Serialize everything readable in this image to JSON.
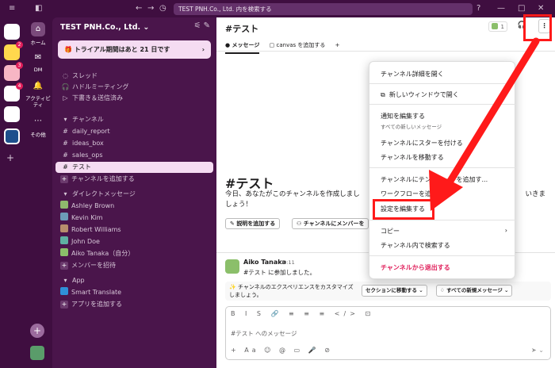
{
  "titlebar": {
    "search_text": "TEST PNH.Co., Ltd. 内を検索する",
    "help": "?",
    "min": "—",
    "max": "□",
    "close": "✕"
  },
  "rail": {
    "ws_badges": [
      "2",
      "3",
      "4"
    ]
  },
  "nav": [
    {
      "icon": "⌂",
      "label": "ホーム"
    },
    {
      "icon": "✉",
      "label": "DM"
    },
    {
      "icon": "🔔",
      "label": "アクティビティ"
    },
    {
      "icon": "⋯",
      "label": "その他"
    }
  ],
  "sidebar": {
    "workspace": "TEST PNH.Co., Ltd.",
    "trial": "トライアル期間はあと 21 日です",
    "threads": "スレッド",
    "huddles": "ハドルミーティング",
    "drafts": "下書き＆送信済み",
    "channels_header": "チャンネル",
    "channels": [
      "daily_report",
      "ideas_box",
      "sales_ops",
      "テスト"
    ],
    "add_channel": "チャンネルを追加する",
    "dm_header": "ダイレクトメッセージ",
    "dms": [
      "Ashley Brown",
      "Kevin Kim",
      "Robert Williams",
      "John Doe",
      "Aiko Tanaka（自分）"
    ],
    "invite": "メンバーを招待",
    "apps_header": "App",
    "apps": [
      "Smart Translate"
    ],
    "add_app": "アプリを追加する"
  },
  "main": {
    "channel_title": "#テスト",
    "member_count": "1",
    "tabs": [
      "メッセージ",
      "canvas を追加する",
      "+"
    ],
    "big_title": "#テスト",
    "intro": "今日、あなたがこのチャンネルを作成しまし",
    "intro_tail": "いきま",
    "intro_line2": "しょう！",
    "add_desc": "説明を追加する",
    "add_member": "チャンネルにメンバーを",
    "msg_name": "Aiko Tanaka",
    "msg_time": "09:11",
    "msg_text": "#テスト に参加しました。",
    "banner_text1": "✨ チャンネルのエクスペリエンスをカスタマイズ",
    "banner_text2": "しましょう。",
    "banner_btn1": "セクションに移動する ⌄",
    "banner_btn2": "すべての新規メッセージ ⌄",
    "placeholder": "#テスト へのメッセージ",
    "fmt_icons": "B I S 🔗 ≡ ≡ ≡ </> ⊡",
    "bottom_icons": "+ Aa ☺ @ ▭ 🎤 ⊘",
    "send": "➤ ⌄"
  },
  "menu": {
    "items": [
      "チャンネル詳細を開く",
      "新しいウィンドウで開く",
      "通知を編集する",
      "すべての新しいメッセージ",
      "チャンネルにスターを付ける",
      "チャンネルを移動する",
      "チャンネルにテンプレートを追加す...",
      "ワークフローを追加",
      "設定を編集する",
      "コピー",
      "チャンネル内で検索する",
      "チャンネルから退出する"
    ]
  },
  "colors": {
    "aubergine": "#3f0e40",
    "sidebar": "#4a154b",
    "annotation": "#ff1a1a",
    "danger": "#e01e5a"
  }
}
